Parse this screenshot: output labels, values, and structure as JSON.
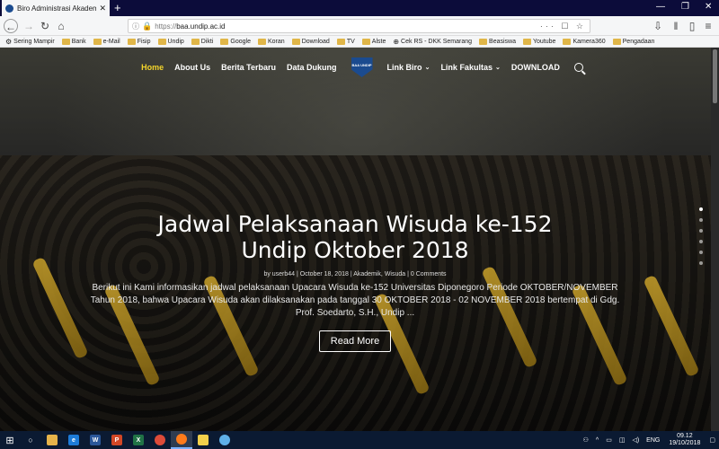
{
  "browser": {
    "tab_title": "Biro Administrasi Akademik Un",
    "url_protocol": "https://",
    "url_host": "baa.undip.ac.id",
    "url_actions": "··· ☐ ☆"
  },
  "bookmarks": [
    {
      "label": "Sering Mampir",
      "icon": "gear-icon"
    },
    {
      "label": "Bank",
      "icon": "folder-icon"
    },
    {
      "label": "e-Mail",
      "icon": "folder-icon"
    },
    {
      "label": "Fisip",
      "icon": "folder-icon"
    },
    {
      "label": "Undip",
      "icon": "folder-icon"
    },
    {
      "label": "Dikti",
      "icon": "folder-icon"
    },
    {
      "label": "Google",
      "icon": "folder-icon"
    },
    {
      "label": "Koran",
      "icon": "folder-icon"
    },
    {
      "label": "Download",
      "icon": "folder-icon"
    },
    {
      "label": "TV",
      "icon": "folder-icon"
    },
    {
      "label": "Alste",
      "icon": "folder-icon"
    },
    {
      "label": "Cek RS - DKK Semarang",
      "icon": "globe-icon"
    },
    {
      "label": "Beasiswa",
      "icon": "folder-icon"
    },
    {
      "label": "Youtube",
      "icon": "folder-icon"
    },
    {
      "label": "Kamera360",
      "icon": "folder-icon"
    },
    {
      "label": "Pengadaan",
      "icon": "folder-icon"
    }
  ],
  "site_nav": {
    "items": [
      "Home",
      "About Us",
      "Berita Terbaru",
      "Data Dukung"
    ],
    "logo_text": "BAA UNDIP",
    "items_right": [
      "Link Biro",
      "Link Fakultas",
      "DOWNLOAD"
    ]
  },
  "hero": {
    "title_line1": "Jadwal Pelaksanaan Wisuda ke-152",
    "title_line2": "Undip Oktober 2018",
    "meta": "by userb44 | October 18, 2018 | Akademik, Wisuda | 0 Comments",
    "excerpt": "Berikut ini Kami informasikan jadwal pelaksanaan Upacara Wisuda ke-152 Universitas Diponegoro Periode OKTOBER/NOVEMBER Tahun 2018, bahwa Upacara Wisuda akan dilaksanakan pada tanggal 30 OKTOBER 2018 - 02 NOVEMBER 2018 bertempat di Gdg. Prof. Soedarto, S.H., Undip ...",
    "button": "Read More"
  },
  "taskbar": {
    "lang": "ENG",
    "time": "09.12",
    "date": "19/10/2018"
  },
  "colors": {
    "active_nav": "#f3d42b",
    "taskbar": "#0b1a32"
  }
}
